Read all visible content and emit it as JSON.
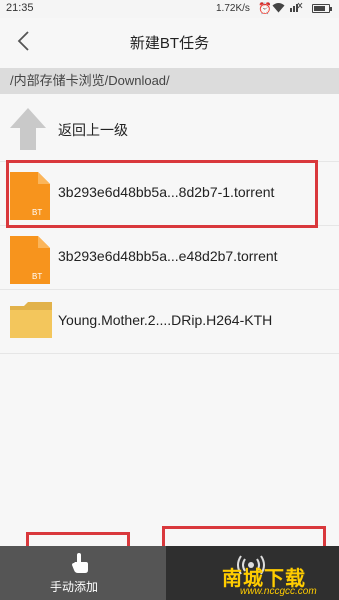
{
  "status_bar": {
    "time": "21:35",
    "net_speed": "1.72K/s",
    "battery_level": 0.8
  },
  "header": {
    "title": "新建BT任务"
  },
  "path": "/内部存储卡浏览/Download/",
  "files": [
    {
      "label": "返回上一级",
      "icon": "up-arrow-icon"
    },
    {
      "label": "3b293e6d48bb5a...8d2b7-1.torrent",
      "icon": "bt-file-icon",
      "badge": "BT"
    },
    {
      "label": "3b293e6d48bb5a...e48d2b7.torrent",
      "icon": "bt-file-icon",
      "badge": "BT"
    },
    {
      "label": "Young.Mother.2....DRip.H264-KTH",
      "icon": "folder-icon"
    }
  ],
  "bottom": {
    "manual_add": "手动添加"
  },
  "watermark": {
    "main": "南城下载",
    "sub": "www.nccgcc.com"
  },
  "colors": {
    "highlight": "#d9383c",
    "bt_orange": "#f7941d",
    "folder_yellow": "#f3c65c"
  }
}
